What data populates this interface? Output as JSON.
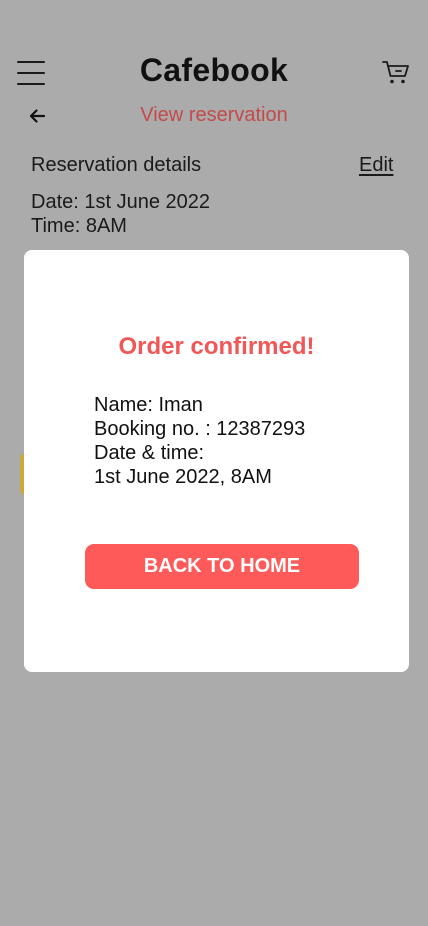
{
  "header": {
    "app_title": "Cafebook",
    "menu_icon": "hamburger-menu-icon",
    "cart_icon": "cart-icon"
  },
  "subheader": {
    "back_icon": "arrow-left-icon",
    "title": "View reservation"
  },
  "reservation": {
    "section_title": "Reservation details",
    "edit_label": "Edit",
    "date_line": "Date: 1st June 2022",
    "time_line": "Time: 8AM"
  },
  "modal": {
    "title": "Order confirmed!",
    "name_line": "Name: Iman",
    "booking_line": "Booking no. : 12387293",
    "datetime_label": "Date & time:",
    "datetime_value": "1st June 2022, 8AM",
    "button_label": "BACK TO HOME"
  },
  "colors": {
    "overlay_background": "#ababab",
    "accent": "#fe5a5a",
    "subtitle": "#c44a4a",
    "modal_background": "#ffffff",
    "yellow_tab": "#c9a93a"
  }
}
